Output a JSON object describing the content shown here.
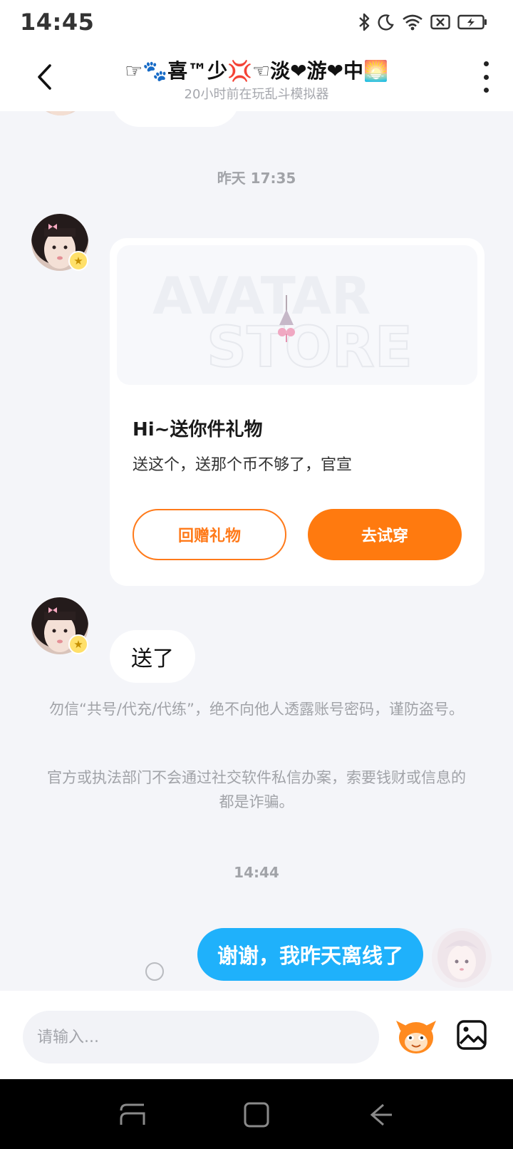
{
  "status_bar": {
    "time": "14:45",
    "icons": [
      "bluetooth-icon",
      "moon-icon",
      "wifi-icon",
      "sim-off-icon",
      "battery-charging-icon"
    ]
  },
  "header": {
    "title": "☞🐾喜™少💢☜淡❤游❤中🌅",
    "subtitle": "20小时前在玩乱斗模拟器",
    "back_icon": "chevron-left-icon",
    "more_icon": "more-vertical-icon"
  },
  "messages": {
    "timestamp_1": "昨天 17:35",
    "gift_card": {
      "image_text_line1": "AVATAR",
      "image_text_line2": "STORE",
      "title": "Hi~送你件礼物",
      "description": "送这个，送那个币不够了，官宣",
      "return_gift_label": "回赠礼物",
      "try_on_label": "去试穿"
    },
    "bubble_received": "送了",
    "notice_1": "勿信“共号/代充/代练”，绝不向他人透露账号密码，谨防盗号。",
    "notice_2": "官方或执法部门不会通过社交软件私信办案，索要钱财或信息的都是诈骗。",
    "timestamp_2": "14:44",
    "bubble_sent": "谢谢，我昨天离线了"
  },
  "input_bar": {
    "placeholder": "请输入...",
    "emoji_icon": "emoji-mascot-icon",
    "image_icon": "image-icon"
  },
  "nav_bar": {
    "icons": [
      "recents-icon",
      "home-icon",
      "back-icon"
    ]
  },
  "colors": {
    "accent_orange": "#ff7a0f",
    "sent_bubble_blue": "#1fb1fb",
    "background": "#f4f5f9"
  }
}
